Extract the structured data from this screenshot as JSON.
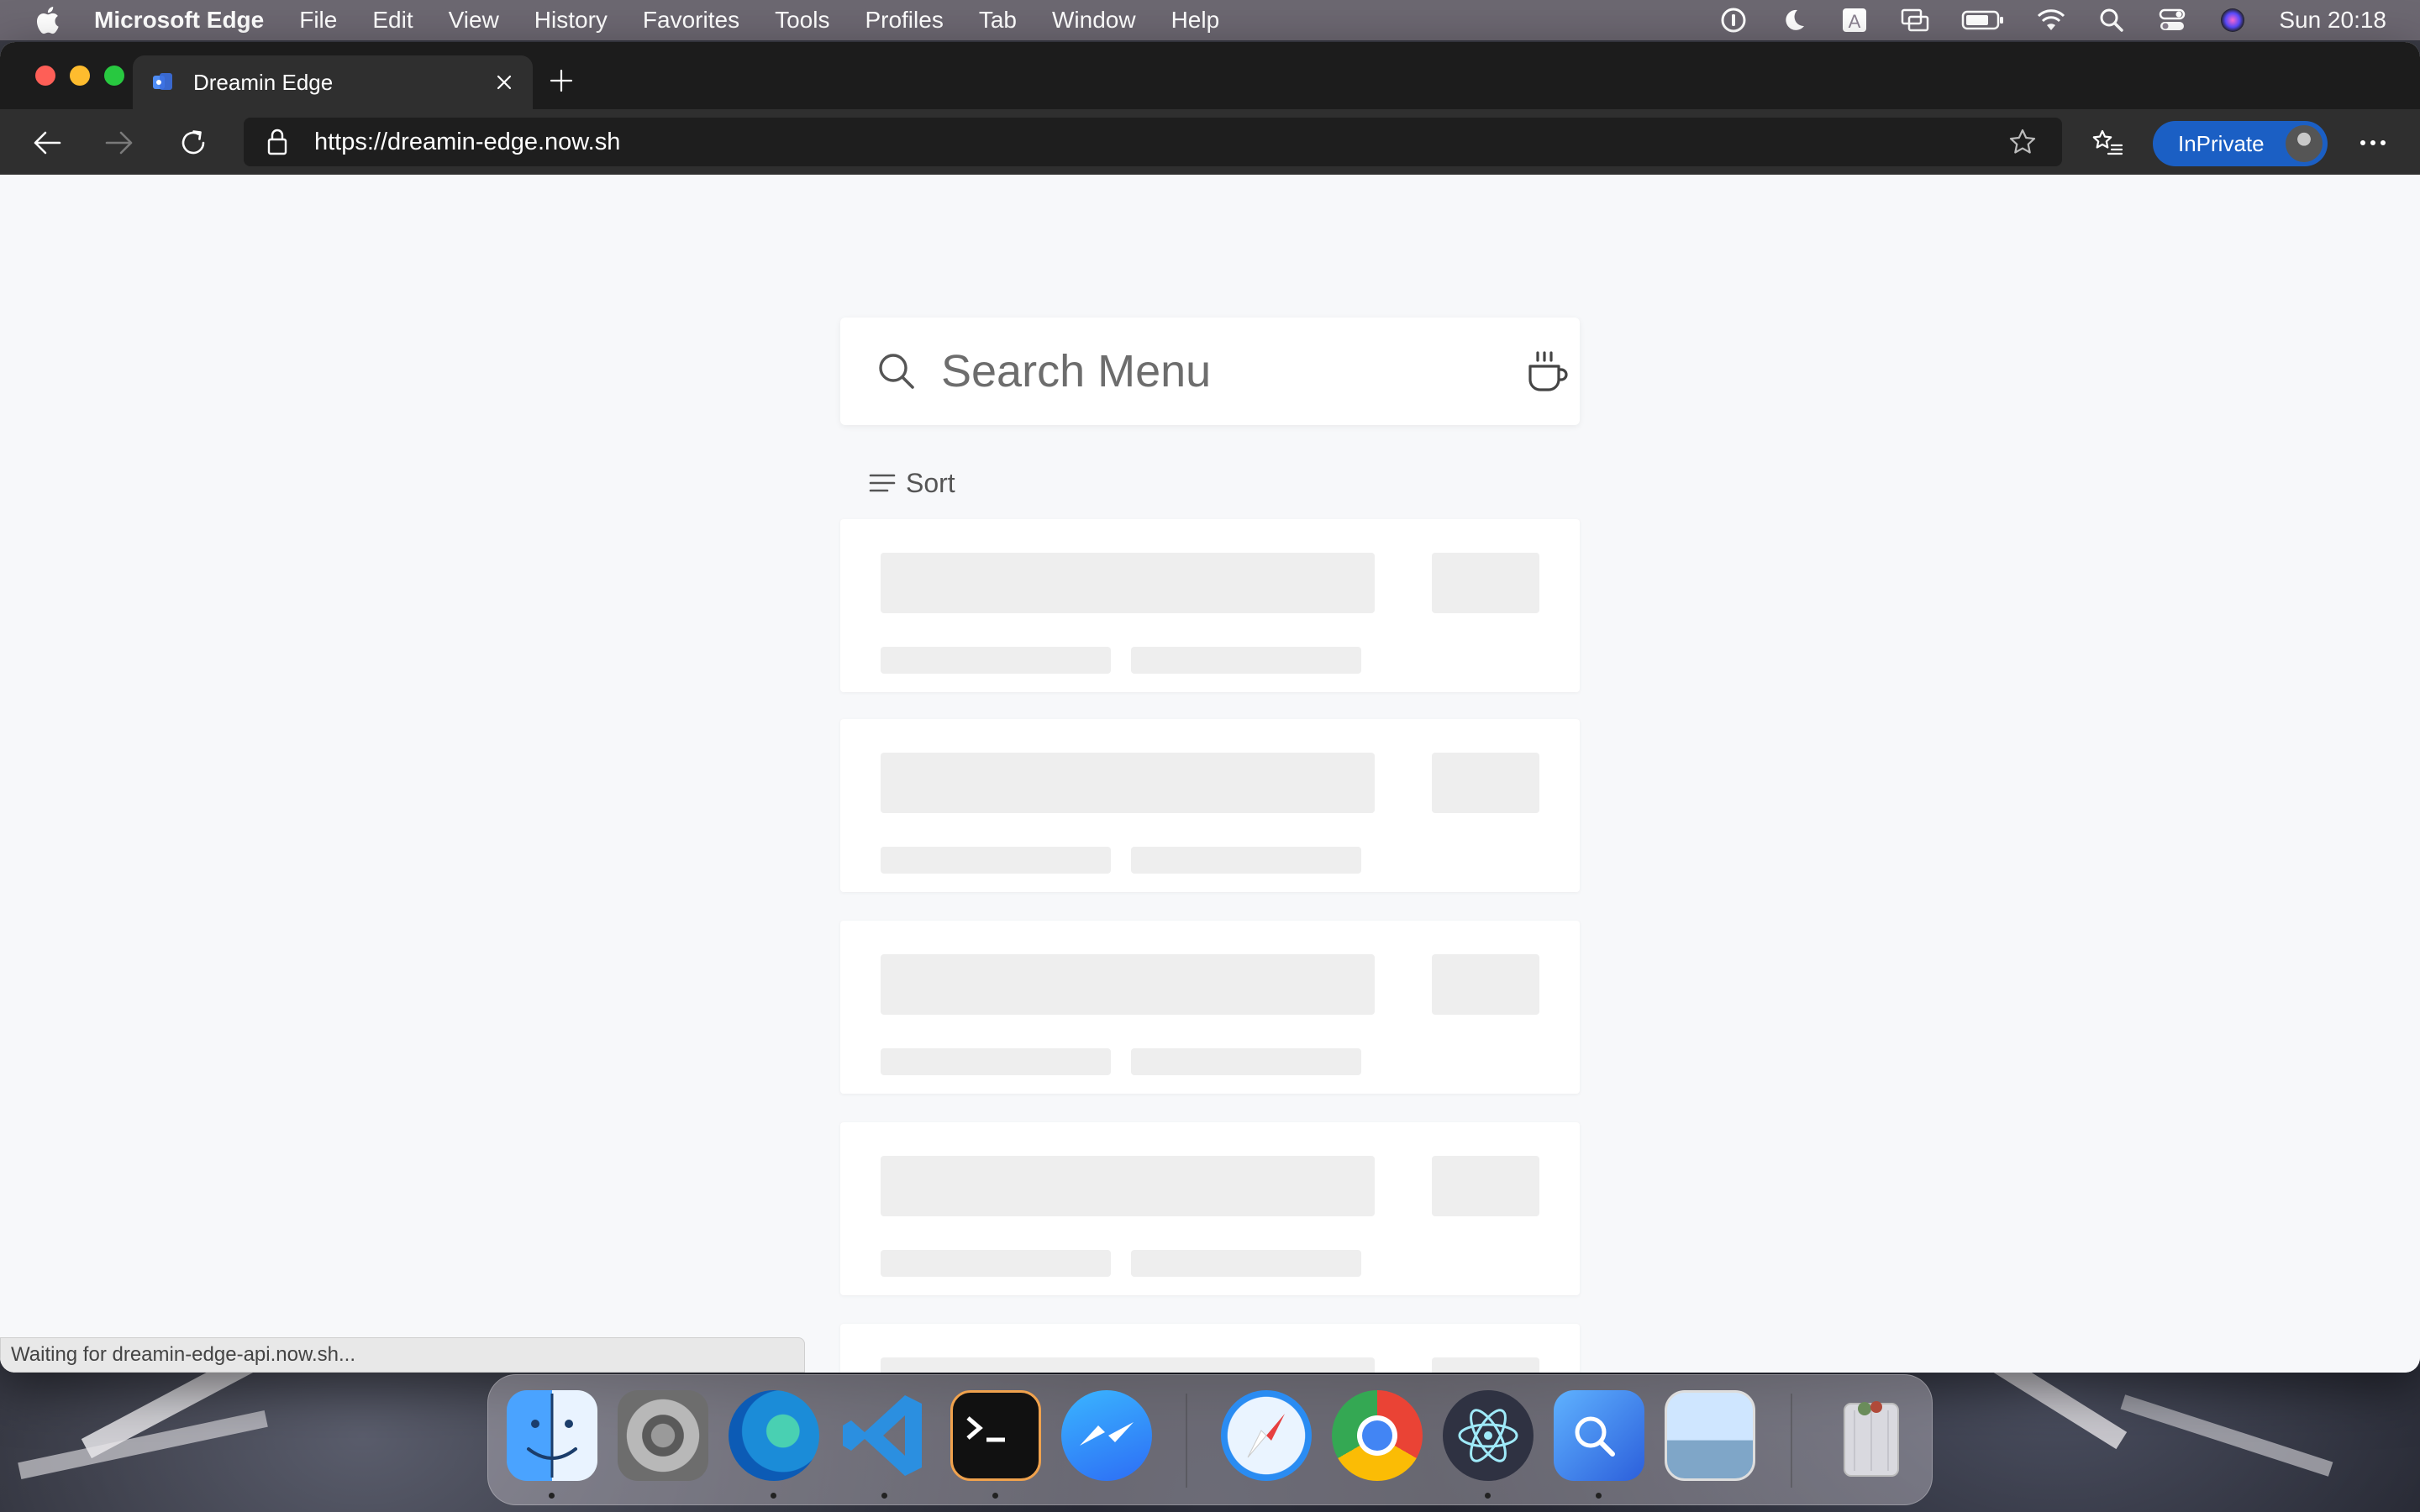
{
  "menubar": {
    "app_name": "Microsoft Edge",
    "items": [
      "File",
      "Edit",
      "View",
      "History",
      "Favorites",
      "Tools",
      "Profiles",
      "Tab",
      "Window",
      "Help"
    ],
    "clock": "Sun 20:18",
    "status_icons": [
      "onepassword-icon",
      "moon-icon",
      "input-source-icon",
      "screen-mirroring-icon",
      "battery-icon",
      "wifi-icon",
      "spotlight-icon",
      "control-center-icon",
      "siri-icon"
    ]
  },
  "browser": {
    "tab": {
      "title": "Dreamin Edge"
    },
    "address": {
      "url": "https://dreamin-edge.now.sh"
    },
    "inprivate_label": "InPrivate",
    "status_text": "Waiting for dreamin-edge-api.now.sh..."
  },
  "page": {
    "search": {
      "placeholder": "Search Menu"
    },
    "sort_label": "Sort",
    "skeleton_cards": 5
  },
  "dock": {
    "apps": [
      "Finder",
      "System Preferences",
      "Microsoft Edge",
      "Visual Studio Code",
      "Terminal",
      "Messenger",
      "Safari",
      "Google Chrome",
      "Electron",
      "Proxyman",
      "Preview",
      "Trash"
    ]
  },
  "colors": {
    "accent": "#1b5fc4",
    "skeleton": "#eeeeee",
    "page_bg": "#f7f8fa"
  }
}
